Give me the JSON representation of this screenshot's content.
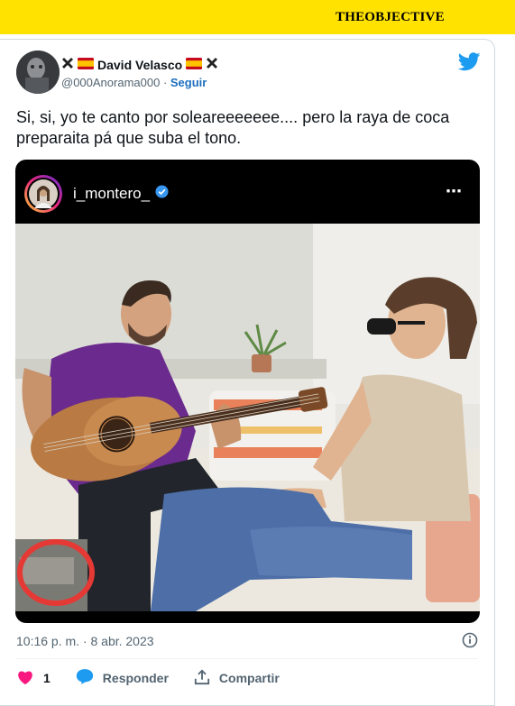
{
  "header": {
    "brand_part1": "THE",
    "brand_part2": "OBJECTIVE"
  },
  "tweet": {
    "display_name": "David Velasco",
    "handle": "@000Anorama000",
    "separator": " · ",
    "follow_label": "Seguir",
    "text": "Si, si, yo te canto por soleareeeeeee.... pero la raya de coca preparaita pá que suba el tono.",
    "timestamp": "10:16 p. m. · 8 abr. 2023",
    "like_count": "1",
    "reply_label": "Responder",
    "share_label": "Compartir"
  },
  "embedded_post": {
    "username": "i_montero_",
    "verified": true,
    "more_icon": "⋯"
  },
  "colors": {
    "banner": "#ffe200",
    "twitter_blue": "#1d9bf0",
    "like_pink": "#f91880",
    "annotation_circle": "#e53935"
  },
  "icons": [
    "twitter-bird-icon",
    "maltese-cross-icon",
    "spain-flag-icon",
    "verified-badge-icon",
    "more-options-icon",
    "info-icon",
    "heart-icon",
    "reply-icon",
    "share-icon"
  ]
}
